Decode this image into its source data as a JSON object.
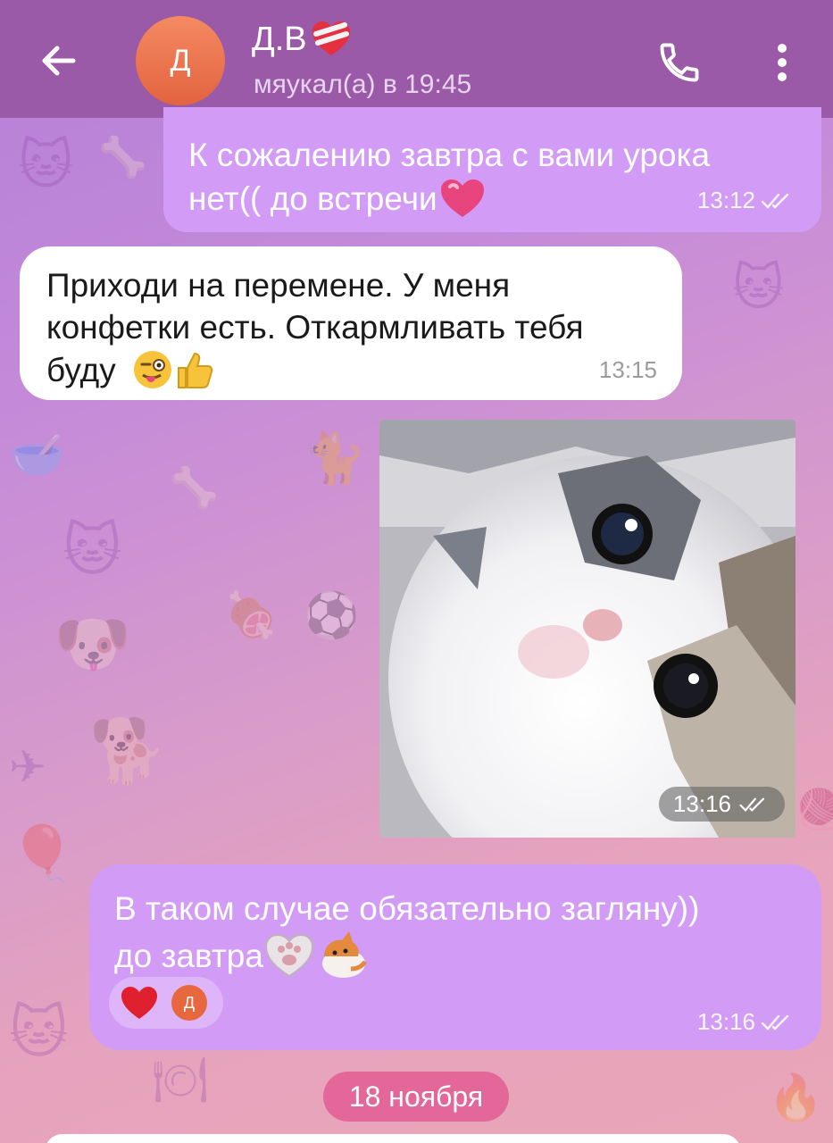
{
  "header": {
    "back_icon": "arrow-left-icon",
    "avatar_letter": "Д",
    "avatar_color": "#e8683f",
    "title": "Д.В",
    "title_emoji": "mending-heart-icon",
    "status": "мяукал(а) в 19:45",
    "call_icon": "phone-icon",
    "menu_icon": "more-vertical-icon",
    "bar_color": "#9a5aa8"
  },
  "messages": [
    {
      "direction": "outgoing",
      "lines": [
        "К сожалению завтра с вами урока",
        "нет(( до встречи"
      ],
      "emoji": "pink-heart-icon",
      "time": "13:12",
      "read": true
    },
    {
      "direction": "incoming",
      "lines": [
        "Приходи на перемене. У меня",
        "конфетки есть. Откармливать тебя",
        "буду"
      ],
      "emoji": "winking-tongue-face-icon, thumbs-up-icon",
      "time": "13:15"
    },
    {
      "direction": "outgoing",
      "type": "photo",
      "photo_subject": "kitten",
      "time": "13:16",
      "read": true
    },
    {
      "direction": "outgoing",
      "lines": [
        "В таком случае обязательно загляну))",
        "до завтра"
      ],
      "emoji": "cat-paw-heart-icon, kitten-icon",
      "reaction_emoji": "red-heart-icon",
      "reaction_user_letter": "Д",
      "time": "13:16",
      "read": true
    }
  ],
  "date_divider": "18 ноября",
  "colors": {
    "outgoing_bubble": "#d29cf6",
    "incoming_bubble": "#ffffff",
    "date_pill": "#e36798"
  }
}
